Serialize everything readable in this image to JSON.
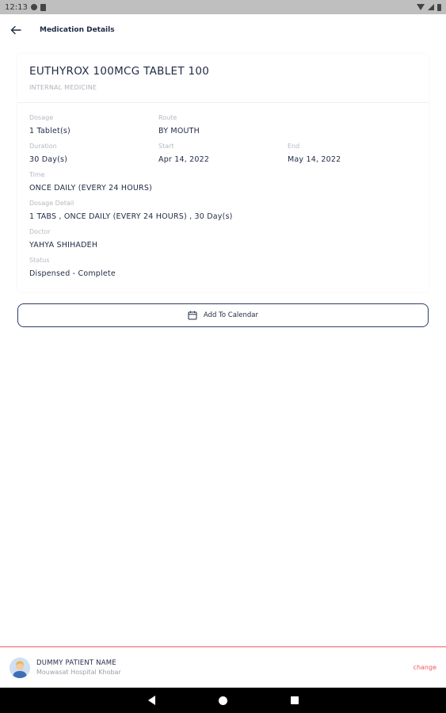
{
  "status_bar": {
    "time": "12:13"
  },
  "header": {
    "title": "Medication Details"
  },
  "medication": {
    "name": "EUTHYROX 100MCG TABLET 100",
    "department": "INTERNAL MEDICINE",
    "fields": {
      "dosage": {
        "label": "Dosage",
        "value": "1 Tablet(s)"
      },
      "route": {
        "label": "Route",
        "value": "BY MOUTH"
      },
      "duration": {
        "label": "Duration",
        "value": "30 Day(s)"
      },
      "start": {
        "label": "Start",
        "value": "Apr 14, 2022"
      },
      "end": {
        "label": "End",
        "value": "May 14, 2022"
      },
      "time": {
        "label": "Time",
        "value": "ONCE DAILY (EVERY 24 HOURS)"
      },
      "dosage_detail": {
        "label": "Dosage Detail",
        "value": "1 TABS , ONCE DAILY (EVERY 24 HOURS) , 30 Day(s)"
      },
      "doctor": {
        "label": "Doctor",
        "value": "YAHYA SHIHADEH"
      },
      "status": {
        "label": "Status",
        "value": "Dispensed - Complete"
      }
    }
  },
  "actions": {
    "add_to_calendar": "Add To Calendar"
  },
  "patient": {
    "name": "DUMMY PATIENT NAME",
    "hospital": "Mouwasat Hospital Khobar",
    "change_label": "change"
  },
  "colors": {
    "primary": "#1f2a44",
    "accent": "#f25a5a",
    "label": "#b5b8c0"
  }
}
